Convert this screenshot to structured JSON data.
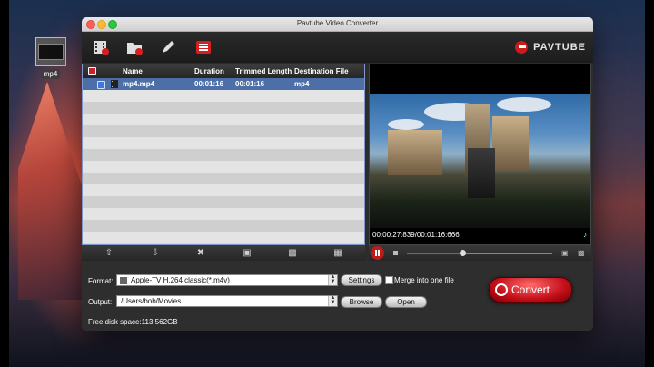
{
  "desktop": {
    "icon_label": "mp4"
  },
  "window": {
    "title": "Pavtube Video Converter"
  },
  "toolbar": {
    "brand": "PAVTUBE"
  },
  "file_list": {
    "columns": [
      "Name",
      "Duration",
      "Trimmed Length",
      "Destination File"
    ],
    "rows": [
      {
        "name": "mp4.mp4",
        "duration": "00:01:16",
        "trimmed": "00:01:16",
        "destination": "mp4"
      }
    ]
  },
  "preview": {
    "time": "00:00:27:839/00:01:16:666",
    "progress": 0.38
  },
  "output": {
    "format_label": "Format:",
    "format_value": "Apple-TV H.264 classic(*.m4v)",
    "settings_label": "Settings",
    "merge_label": "Merge into one file",
    "output_label": "Output:",
    "output_value": "/Users/bob/Movies",
    "browse_label": "Browse",
    "open_label": "Open",
    "free_disk": "Free disk space:113.562GB",
    "convert_label": "Convert"
  }
}
